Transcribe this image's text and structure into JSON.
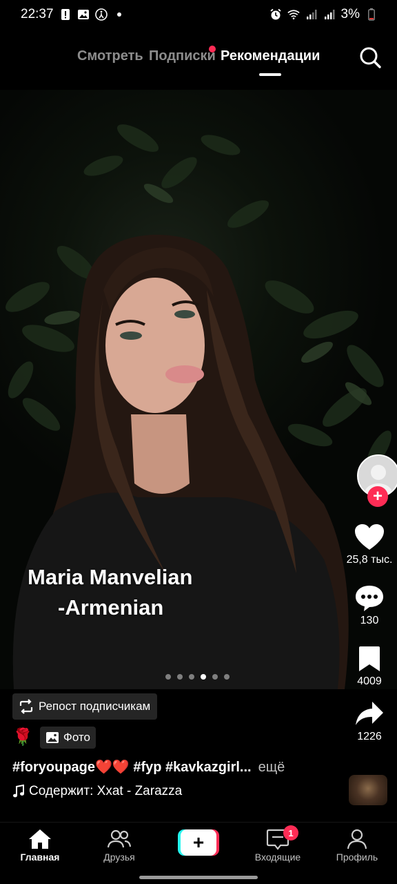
{
  "status_bar": {
    "time": "22:37",
    "battery": "3%",
    "icons": [
      "alert-icon",
      "image-icon",
      "accessibility-icon",
      "dot-icon",
      "alarm-icon",
      "wifi-icon",
      "signal-icon",
      "signal-icon",
      "battery-low-icon"
    ]
  },
  "top_tabs": {
    "watch": "Смотреть",
    "subscriptions": "Подписки",
    "recommendations": "Рекомендации",
    "active": "recommendations"
  },
  "post": {
    "caption_line1": "Maria Manvelian",
    "caption_line2": "-Armenian",
    "slides_total": 6,
    "slide_active": 4,
    "repost_label": "Репост подписчикам",
    "emoji": "🌹",
    "photo_badge": "Фото",
    "hashtags": "#foryoupage❤️❤️ #fyp #kavkazgirl...",
    "more": "ещё",
    "music": "Содержит: Xxat - Zarazza"
  },
  "actions": {
    "likes": "25,8 тыс.",
    "comments": "130",
    "saves": "4009",
    "shares": "1226"
  },
  "bottom_nav": {
    "home": "Главная",
    "friends": "Друзья",
    "inbox": "Входящие",
    "inbox_badge": "1",
    "profile": "Профиль",
    "create": "+"
  },
  "colors": {
    "accent": "#fe2c55",
    "cyan": "#25f4ee",
    "background": "#000000"
  }
}
